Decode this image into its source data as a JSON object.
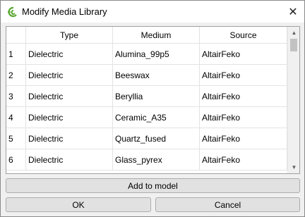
{
  "window": {
    "title": "Modify Media Library",
    "close_glyph": "✕",
    "app_icon": "altair-feko-icon"
  },
  "table": {
    "columns": [
      "Type",
      "Medium",
      "Source"
    ],
    "rows": [
      {
        "num": "1",
        "type": "Dielectric",
        "medium": "Alumina_99p5",
        "source": "AltairFeko"
      },
      {
        "num": "2",
        "type": "Dielectric",
        "medium": "Beeswax",
        "source": "AltairFeko"
      },
      {
        "num": "3",
        "type": "Dielectric",
        "medium": "Beryllia",
        "source": "AltairFeko"
      },
      {
        "num": "4",
        "type": "Dielectric",
        "medium": "Ceramic_A35",
        "source": "AltairFeko"
      },
      {
        "num": "5",
        "type": "Dielectric",
        "medium": "Quartz_fused",
        "source": "AltairFeko"
      },
      {
        "num": "6",
        "type": "Dielectric",
        "medium": "Glass_pyrex",
        "source": "AltairFeko"
      }
    ]
  },
  "buttons": {
    "add": "Add to model",
    "ok": "OK",
    "cancel": "Cancel"
  },
  "colors": {
    "icon_green": "#5aa832",
    "grid_line": "#e3e3e3"
  }
}
